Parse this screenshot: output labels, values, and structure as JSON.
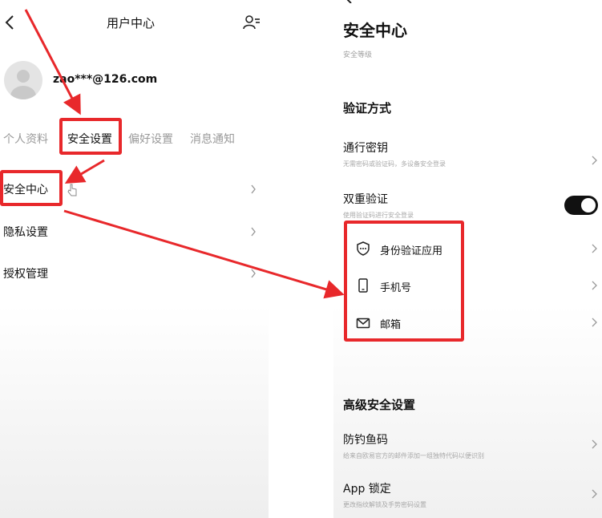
{
  "left": {
    "header": {
      "title": "用户中心",
      "back_icon": "chevron-left-icon",
      "switch_icon": "user-switch-icon"
    },
    "user": {
      "email": "zao***@126.com",
      "avatar_icon": "avatar-placeholder-icon"
    },
    "tabs": [
      {
        "label": "个人资料",
        "active": false
      },
      {
        "label": "安全设置",
        "active": true
      },
      {
        "label": "偏好设置",
        "active": false
      },
      {
        "label": "消息通知",
        "active": false
      }
    ],
    "menu": [
      {
        "label": "安全中心"
      },
      {
        "label": "隐私设置"
      },
      {
        "label": "授权管理"
      }
    ]
  },
  "right": {
    "title": "安全中心",
    "subtitle": "安全等级",
    "section_verify": "验证方式",
    "passkey": {
      "title": "通行密钥",
      "desc": "无需密码或验证码，多设备安全登录"
    },
    "two_factor": {
      "title": "双重验证",
      "desc": "使用验证码进行安全登录",
      "enabled": true
    },
    "sub_options": [
      {
        "label": "身份验证应用",
        "icon": "shield-icon"
      },
      {
        "label": "手机号",
        "icon": "phone-icon"
      },
      {
        "label": "邮箱",
        "icon": "mail-icon"
      }
    ],
    "section_advanced": "高级安全设置",
    "anti_phishing": {
      "title": "防钓鱼码",
      "desc": "给来自欧易官方的邮件添加一组独特代码以便识别"
    },
    "app_lock": {
      "title": "App 锁定",
      "desc": "更改指纹解锁及手势密码设置"
    }
  },
  "colors": {
    "highlight": "#e8282b",
    "text": "#111111",
    "muted": "#9a9a9a",
    "toggle_on": "#111111"
  }
}
